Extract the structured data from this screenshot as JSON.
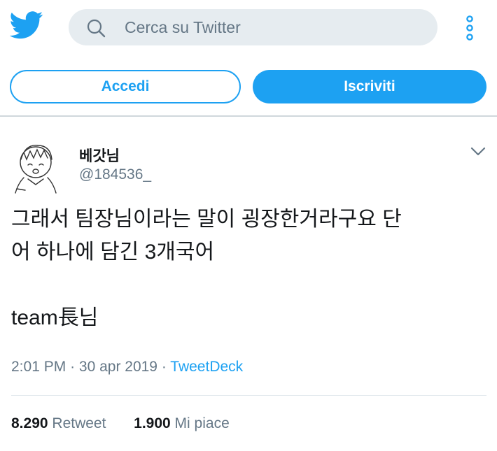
{
  "header": {
    "search_placeholder": "Cerca su Twitter",
    "login_label": "Accedi",
    "signup_label": "Iscriviti"
  },
  "tweet": {
    "author_name": "베갓님",
    "author_handle": "@184536_",
    "text_lines": [
      "그래서 팀장님이라는 말이 굉장한거라구요 단",
      "어 하나에 담긴 3개국어",
      "",
      "team長님"
    ],
    "time": "2:01 PM",
    "date": "30 apr 2019",
    "source": "TweetDeck",
    "retweet_count": "8.290",
    "retweet_label": "Retweet",
    "like_count": "1.900",
    "like_label": "Mi piace"
  },
  "colors": {
    "brand": "#1da1f2",
    "secondary_text": "#657786",
    "search_bg": "#e6ecf0"
  },
  "icons": [
    "twitter-bird-icon",
    "search-icon",
    "more-vertical-icon",
    "chevron-down-icon",
    "avatar-sketch"
  ]
}
